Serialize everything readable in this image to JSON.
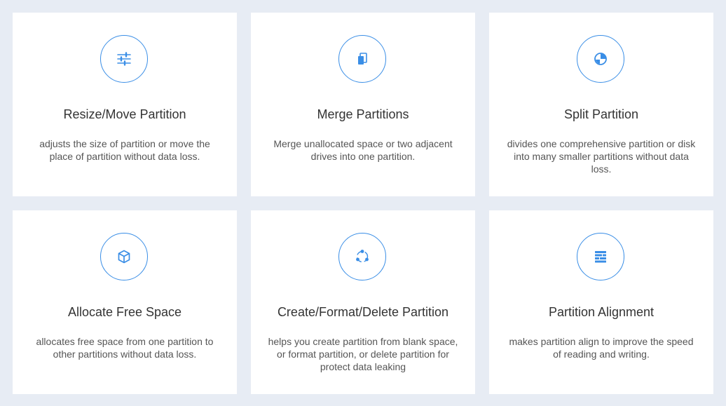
{
  "accent_color": "#3a8ee6",
  "cards": [
    {
      "icon": "sliders-icon",
      "title": "Resize/Move Partition",
      "description": "adjusts the size of partition or move the place of partition without data loss."
    },
    {
      "icon": "merge-icon",
      "title": "Merge Partitions",
      "description": "Merge unallocated space or two adjacent drives into one partition."
    },
    {
      "icon": "pie-split-icon",
      "title": "Split Partition",
      "description": "divides one comprehensive partition or disk into many smaller partitions without data loss."
    },
    {
      "icon": "cube-icon",
      "title": "Allocate Free Space",
      "description": "allocates free space from one partition to other partitions without data loss."
    },
    {
      "icon": "cycle-icon",
      "title": "Create/Format/Delete Partition",
      "description": "helps you create partition from blank space, or format partition, or delete partition for protect data leaking"
    },
    {
      "icon": "align-icon",
      "title": "Partition Alignment",
      "description": "makes partition align to improve the speed of reading and writing."
    }
  ]
}
